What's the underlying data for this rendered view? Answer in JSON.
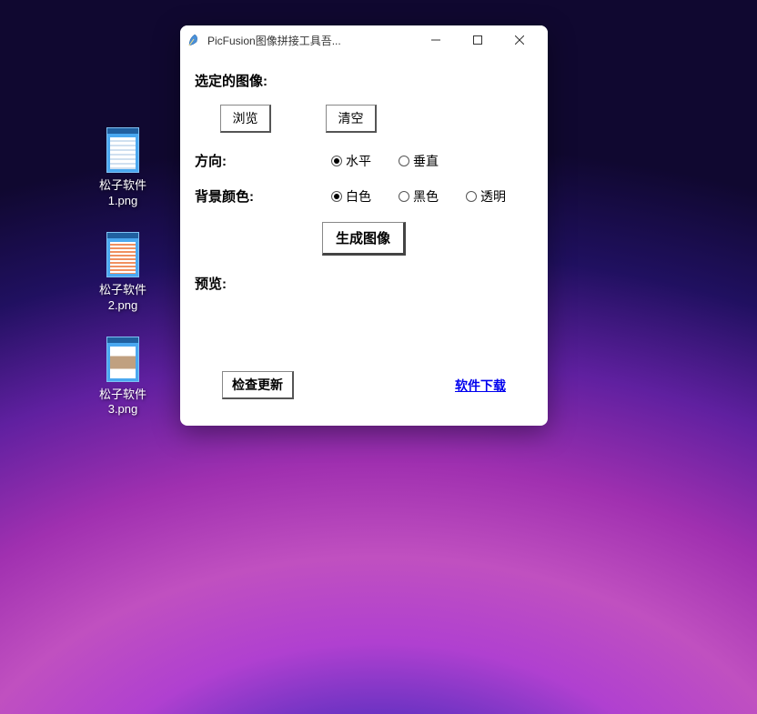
{
  "desktop": {
    "icons": [
      {
        "label": "松子软件\n1.png"
      },
      {
        "label": "松子软件\n2.png"
      },
      {
        "label": "松子软件\n3.png"
      }
    ]
  },
  "window": {
    "title": "PicFusion图像拼接工具吾...",
    "sections": {
      "selected_images_label": "选定的图像:",
      "browse_btn": "浏览",
      "clear_btn": "清空",
      "direction_label": "方向:",
      "direction_options": {
        "horizontal": "水平",
        "vertical": "垂直"
      },
      "direction_selected": "horizontal",
      "bg_color_label": "背景颜色:",
      "bg_color_options": {
        "white": "白色",
        "black": "黑色",
        "transparent": "透明"
      },
      "bg_color_selected": "white",
      "generate_btn": "生成图像",
      "preview_label": "预览:",
      "check_update_btn": "检查更新",
      "download_link": "软件下载"
    }
  }
}
